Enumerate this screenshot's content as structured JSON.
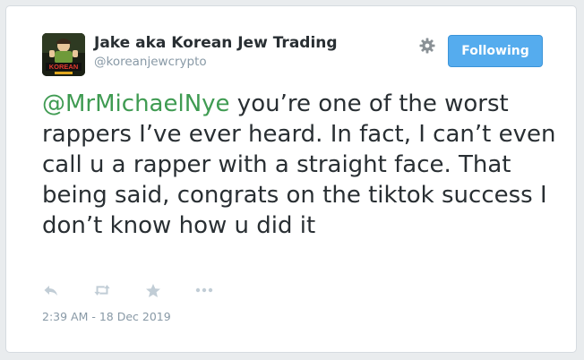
{
  "tweet": {
    "author": {
      "display_name": "Jake aka Korean Jew Trading",
      "handle": "@koreanjewcrypto",
      "avatar_text": "KOREAN"
    },
    "follow_button_label": "Following",
    "mention": "@MrMichaelNye",
    "body": " you’re one of the worst rappers I’ve ever heard. In fact, I can’t even call u a rapper with a straight face. That being said, congrats on the tiktok success I don’t know how u did it",
    "timestamp": "2:39 AM - 18 Dec 2019",
    "actions": [
      {
        "name": "reply",
        "icon": "reply-icon"
      },
      {
        "name": "retweet",
        "icon": "retweet-icon"
      },
      {
        "name": "like",
        "icon": "star-icon"
      },
      {
        "name": "more",
        "icon": "more-icon"
      }
    ],
    "settings_icon": "gear-icon"
  },
  "colors": {
    "mention": "#3f9b52",
    "follow_button": "#55acee",
    "text": "#292f33",
    "muted": "#8899a6",
    "icon": "#c1cdd6"
  }
}
